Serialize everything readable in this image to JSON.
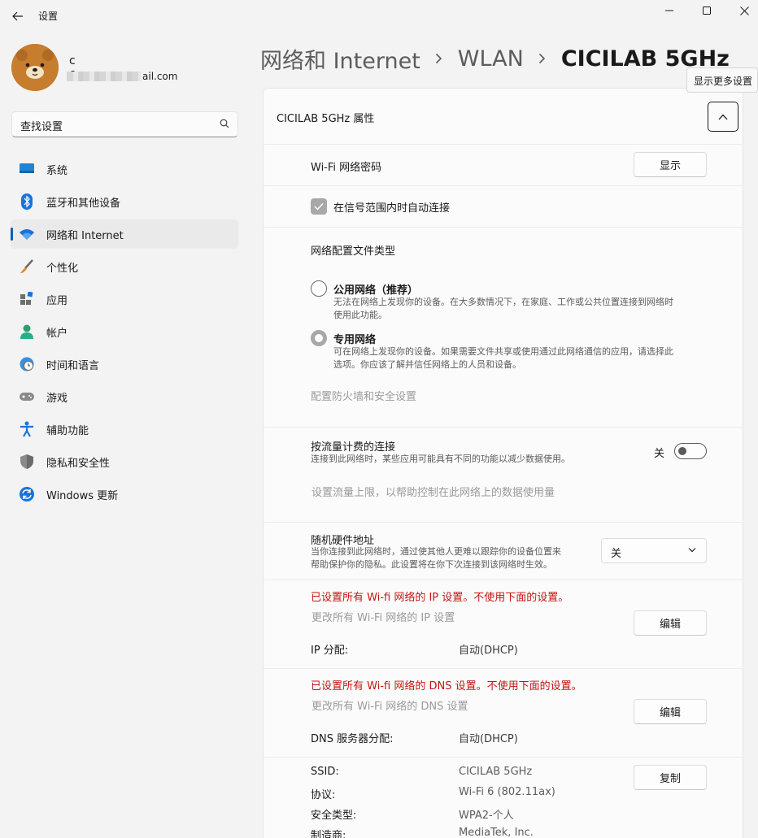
{
  "window": {
    "title": "设置"
  },
  "user": {
    "name": "c c",
    "email_suffix": "ail.com"
  },
  "search": {
    "placeholder": "查找设置"
  },
  "nav": [
    {
      "label": "系统",
      "icon": "system-icon"
    },
    {
      "label": "蓝牙和其他设备",
      "icon": "bluetooth-icon"
    },
    {
      "label": "网络和 Internet",
      "icon": "wifi-icon",
      "active": true
    },
    {
      "label": "个性化",
      "icon": "brush-icon"
    },
    {
      "label": "应用",
      "icon": "apps-icon"
    },
    {
      "label": "帐户",
      "icon": "account-icon"
    },
    {
      "label": "时间和语言",
      "icon": "globe-clock-icon"
    },
    {
      "label": "游戏",
      "icon": "gamepad-icon"
    },
    {
      "label": "辅助功能",
      "icon": "accessibility-icon"
    },
    {
      "label": "隐私和安全性",
      "icon": "shield-icon"
    },
    {
      "label": "Windows 更新",
      "icon": "update-icon"
    }
  ],
  "breadcrumb": [
    "网络和 Internet",
    "WLAN",
    "CICILAB 5GHz"
  ],
  "tooltip": "显示更多设置",
  "props": {
    "title": "CICILAB 5GHz 属性",
    "wifi_password_label": "Wi-Fi 网络密码",
    "show_button": "显示",
    "auto_connect_label": "在信号范围内时自动连接",
    "profile_type_heading": "网络配置文件类型",
    "public_title": "公用网络（推荐）",
    "public_desc_1": "无法在网络上发现你的设备。在大多数情况下，在家庭、工作或公共位置连接到网络时",
    "public_desc_2": "使用此功能。",
    "private_title": "专用网络",
    "private_desc_1": "可在网络上发现你的设备。如果需要文件共享或使用通过此网络通信的应用，请选择此",
    "private_desc_2": "选项。你应该了解并信任网络上的人员和设备。",
    "firewall_link": "配置防火墙和安全设置",
    "metered_title": "按流量计费的连接",
    "metered_desc": "连接到此网络时，某些应用可能具有不同的功能以减少数据使用。",
    "metered_toggle_label": "关",
    "data_limit_link": "设置流量上限，以帮助控制在此网络上的数据使用量",
    "random_mac_title": "随机硬件地址",
    "random_mac_desc_1": "当你连接到此网络时，通过使其他人更难以跟踪你的设备位置来",
    "random_mac_desc_2": "帮助保护你的隐私。此设置将在你下次连接到该网络时生效。",
    "random_mac_value": "关",
    "ip_warning": "已设置所有 Wi-fi 网络的 IP 设置。不使用下面的设置。",
    "ip_change_link": "更改所有 Wi-Fi 网络的 IP 设置",
    "edit_button": "编辑",
    "ip_assign_label": "IP 分配:",
    "ip_assign_value": "自动(DHCP)",
    "dns_warning": "已设置所有 Wi-fi 网络的 DNS 设置。不使用下面的设置。",
    "dns_change_link": "更改所有 Wi-Fi 网络的 DNS 设置",
    "dns_assign_label": "DNS 服务器分配:",
    "dns_assign_value": "自动(DHCP)",
    "copy_button": "复制",
    "details": [
      {
        "label": "SSID:",
        "value": "CICILAB 5GHz"
      },
      {
        "label": "协议:",
        "value": "Wi-Fi 6 (802.11ax)"
      },
      {
        "label": "安全类型:",
        "value": "WPA2-个人"
      },
      {
        "label": "制造商:",
        "value": "MediaTek, Inc."
      }
    ]
  }
}
